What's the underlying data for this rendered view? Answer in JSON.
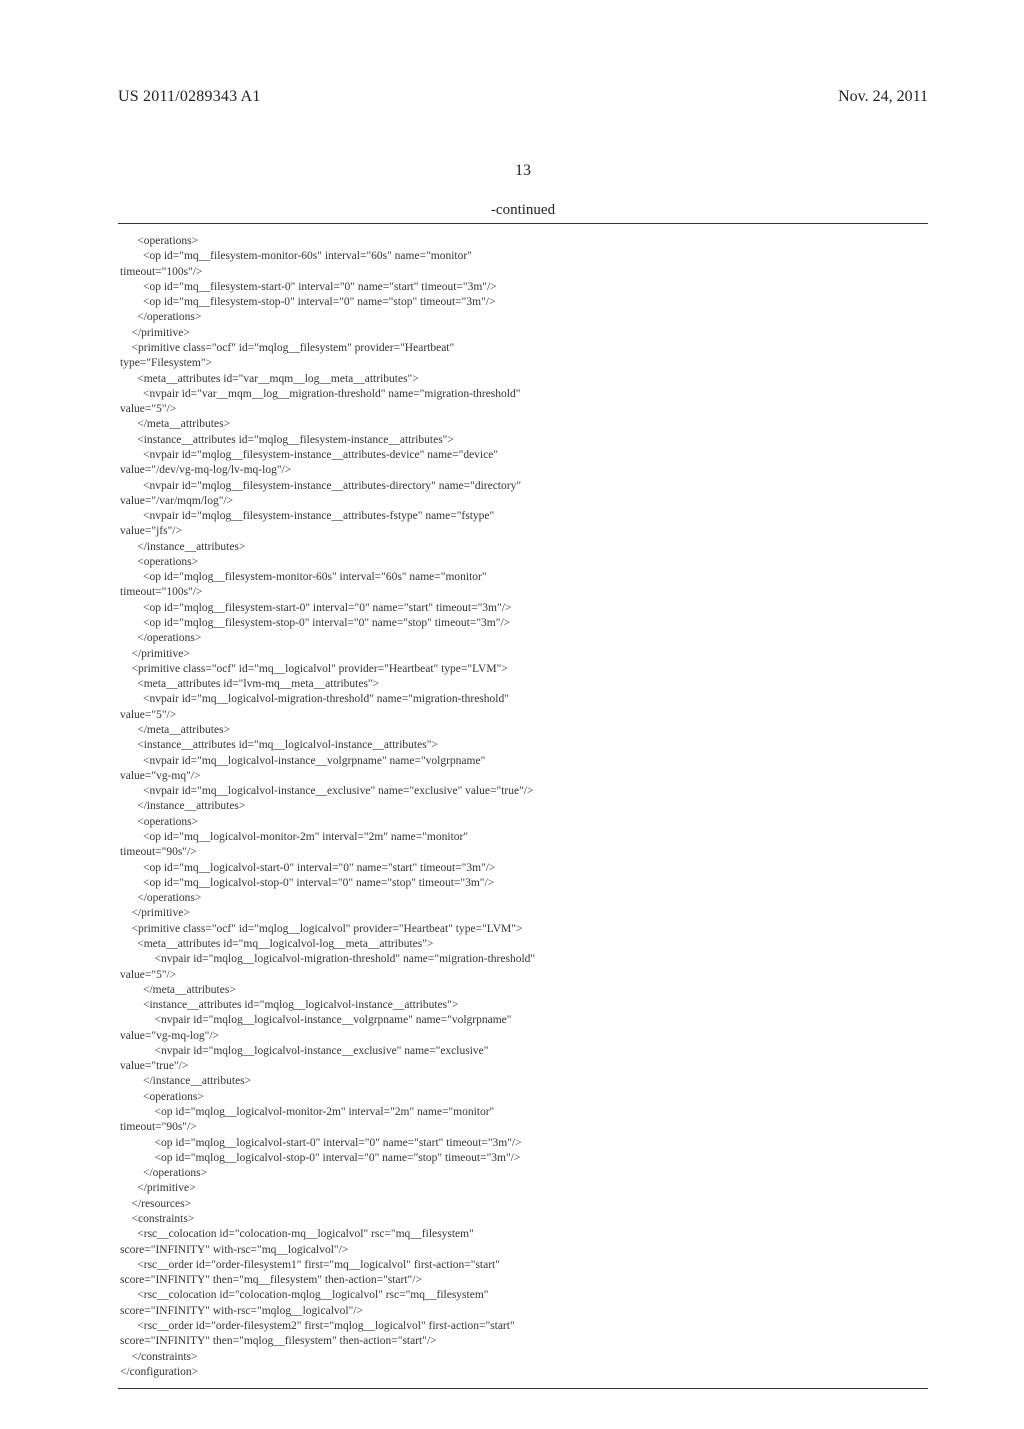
{
  "header": {
    "publication_number": "US 2011/0289343 A1",
    "publication_date": "Nov. 24, 2011"
  },
  "page_number": "13",
  "continued_label": "-continued",
  "code": "      <operations>\n        <op id=\"mq__filesystem-monitor-60s\" interval=\"60s\" name=\"monitor\"\ntimeout=\"100s\"/>\n        <op id=\"mq__filesystem-start-0\" interval=\"0\" name=\"start\" timeout=\"3m\"/>\n        <op id=\"mq__filesystem-stop-0\" interval=\"0\" name=\"stop\" timeout=\"3m\"/>\n      </operations>\n    </primitive>\n    <primitive class=\"ocf\" id=\"mqlog__filesystem\" provider=\"Heartbeat\"\ntype=\"Filesystem\">\n      <meta__attributes id=\"var__mqm__log__meta__attributes\">\n        <nvpair id=\"var__mqm__log__migration-threshold\" name=\"migration-threshold\"\nvalue=\"5\"/>\n      </meta__attributes>\n      <instance__attributes id=\"mqlog__filesystem-instance__attributes\">\n        <nvpair id=\"mqlog__filesystem-instance__attributes-device\" name=\"device\"\nvalue=\"/dev/vg-mq-log/lv-mq-log\"/>\n        <nvpair id=\"mqlog__filesystem-instance__attributes-directory\" name=\"directory\"\nvalue=\"/var/mqm/log\"/>\n        <nvpair id=\"mqlog__filesystem-instance__attributes-fstype\" name=\"fstype\"\nvalue=\"jfs\"/>\n      </instance__attributes>\n      <operations>\n        <op id=\"mqlog__filesystem-monitor-60s\" interval=\"60s\" name=\"monitor\"\ntimeout=\"100s\"/>\n        <op id=\"mqlog__filesystem-start-0\" interval=\"0\" name=\"start\" timeout=\"3m\"/>\n        <op id=\"mqlog__filesystem-stop-0\" interval=\"0\" name=\"stop\" timeout=\"3m\"/>\n      </operations>\n    </primitive>\n    <primitive class=\"ocf\" id=\"mq__logicalvol\" provider=\"Heartbeat\" type=\"LVM\">\n      <meta__attributes id=\"lvm-mq__meta__attributes\">\n        <nvpair id=\"mq__logicalvol-migration-threshold\" name=\"migration-threshold\"\nvalue=\"5\"/>\n      </meta__attributes>\n      <instance__attributes id=\"mq__logicalvol-instance__attributes\">\n        <nvpair id=\"mq__logicalvol-instance__volgrpname\" name=\"volgrpname\"\nvalue=\"vg-mq\"/>\n        <nvpair id=\"mq__logicalvol-instance__exclusive\" name=\"exclusive\" value=\"true\"/>\n      </instance__attributes>\n      <operations>\n        <op id=\"mq__logicalvol-monitor-2m\" interval=\"2m\" name=\"monitor\"\ntimeout=\"90s\"/>\n        <op id=\"mq__logicalvol-start-0\" interval=\"0\" name=\"start\" timeout=\"3m\"/>\n        <op id=\"mq__logicalvol-stop-0\" interval=\"0\" name=\"stop\" timeout=\"3m\"/>\n      </operations>\n    </primitive>\n    <primitive class=\"ocf\" id=\"mqlog__logicalvol\" provider=\"Heartbeat\" type=\"LVM\">\n      <meta__attributes id=\"mq__logicalvol-log__meta__attributes\">\n            <nvpair id=\"mqlog__logicalvol-migration-threshold\" name=\"migration-threshold\"\nvalue=\"5\"/>\n        </meta__attributes>\n        <instance__attributes id=\"mqlog__logicalvol-instance__attributes\">\n            <nvpair id=\"mqlog__logicalvol-instance__volgrpname\" name=\"volgrpname\"\nvalue=\"vg-mq-log\"/>\n            <nvpair id=\"mqlog__logicalvol-instance__exclusive\" name=\"exclusive\"\nvalue=\"true\"/>\n        </instance__attributes>\n        <operations>\n            <op id=\"mqlog__logicalvol-monitor-2m\" interval=\"2m\" name=\"monitor\"\ntimeout=\"90s\"/>\n            <op id=\"mqlog__logicalvol-start-0\" interval=\"0\" name=\"start\" timeout=\"3m\"/>\n            <op id=\"mqlog__logicalvol-stop-0\" interval=\"0\" name=\"stop\" timeout=\"3m\"/>\n        </operations>\n      </primitive>\n    </resources>\n    <constraints>\n      <rsc__colocation id=\"colocation-mq__logicalvol\" rsc=\"mq__filesystem\"\nscore=\"INFINITY\" with-rsc=\"mq__logicalvol\"/>\n      <rsc__order id=\"order-filesystem1\" first=\"mq__logicalvol\" first-action=\"start\"\nscore=\"INFINITY\" then=\"mq__filesystem\" then-action=\"start\"/>\n      <rsc__colocation id=\"colocation-mqlog__logicalvol\" rsc=\"mq__filesystem\"\nscore=\"INFINITY\" with-rsc=\"mqlog__logicalvol\"/>\n      <rsc__order id=\"order-filesystem2\" first=\"mqlog__logicalvol\" first-action=\"start\"\nscore=\"INFINITY\" then=\"mqlog__filesystem\" then-action=\"start\"/>\n    </constraints>\n</configuration>"
}
